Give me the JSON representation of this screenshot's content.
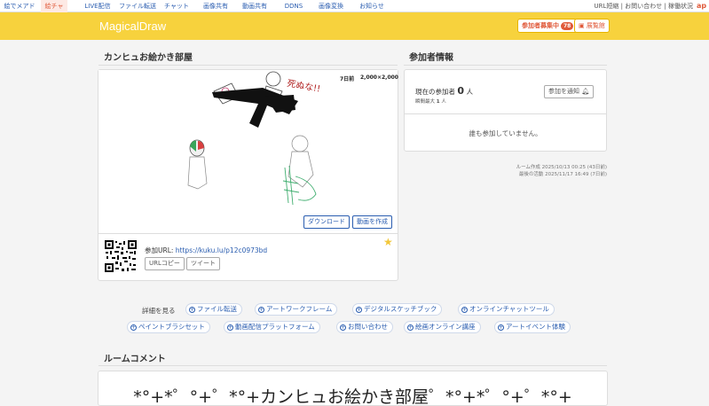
{
  "topnav": {
    "items": [
      "絵でメアド",
      "絵チャ",
      "LIVE配信",
      "ファイル転送",
      "チャット",
      "画像共有",
      "動画共有",
      "DDNS",
      "画像変換",
      "お知らせ"
    ],
    "right_links": "URL短縮 | お問い合わせ | 稼働状況",
    "logo": "ap"
  },
  "header": {
    "brand": "MagicalDraw",
    "recruit_label": "参加者募集中",
    "recruit_count": "78",
    "gallery_label": "展覧館"
  },
  "room": {
    "title": "カンヒュお絵かき部屋",
    "age": "7日前",
    "size": "2,000×2,000",
    "download_label": "ダウンロード",
    "video_label": "動画を作成",
    "join_url_label": "参加URL:",
    "join_url": "https://kuku.lu/p12c0973bd",
    "copy_label": "URLコピー",
    "tweet_label": "ツイート",
    "canvas_text": "死ぬな!!"
  },
  "participants": {
    "title": "参加者情報",
    "current_label": "現在の参加者",
    "current_count": "0",
    "unit": "人",
    "max_label": "瞬間最大",
    "max_count": "1",
    "max_unit": "人",
    "notify_label": "参加を通知",
    "empty_message": "誰も参加していません。",
    "created": "ルーム作成 2025/10/13 00:25 (43日前)",
    "last_activity": "最後の活動 2025/11/17 16:49 (7日前)"
  },
  "details": {
    "label": "詳細を見る",
    "chips_row1": [
      "ファイル転送",
      "アートワークフレーム",
      "デジタルスケッチブック",
      "オンラインチャットツール"
    ],
    "chips_row2": [
      "ペイントブラシセット",
      "動画配信プラットフォーム",
      "お問い合わせ",
      "絵画オンライン講座",
      "アートイベント体験"
    ]
  },
  "comment": {
    "title": "ルームコメント",
    "text": "*°+*゜°+゜*°+カンヒュお絵かき部屋゜*°+*゜°+゜*°+"
  },
  "colors": {
    "header": "#f7d23d",
    "accent": "#2a5db0",
    "badge": "#e05a3a"
  }
}
